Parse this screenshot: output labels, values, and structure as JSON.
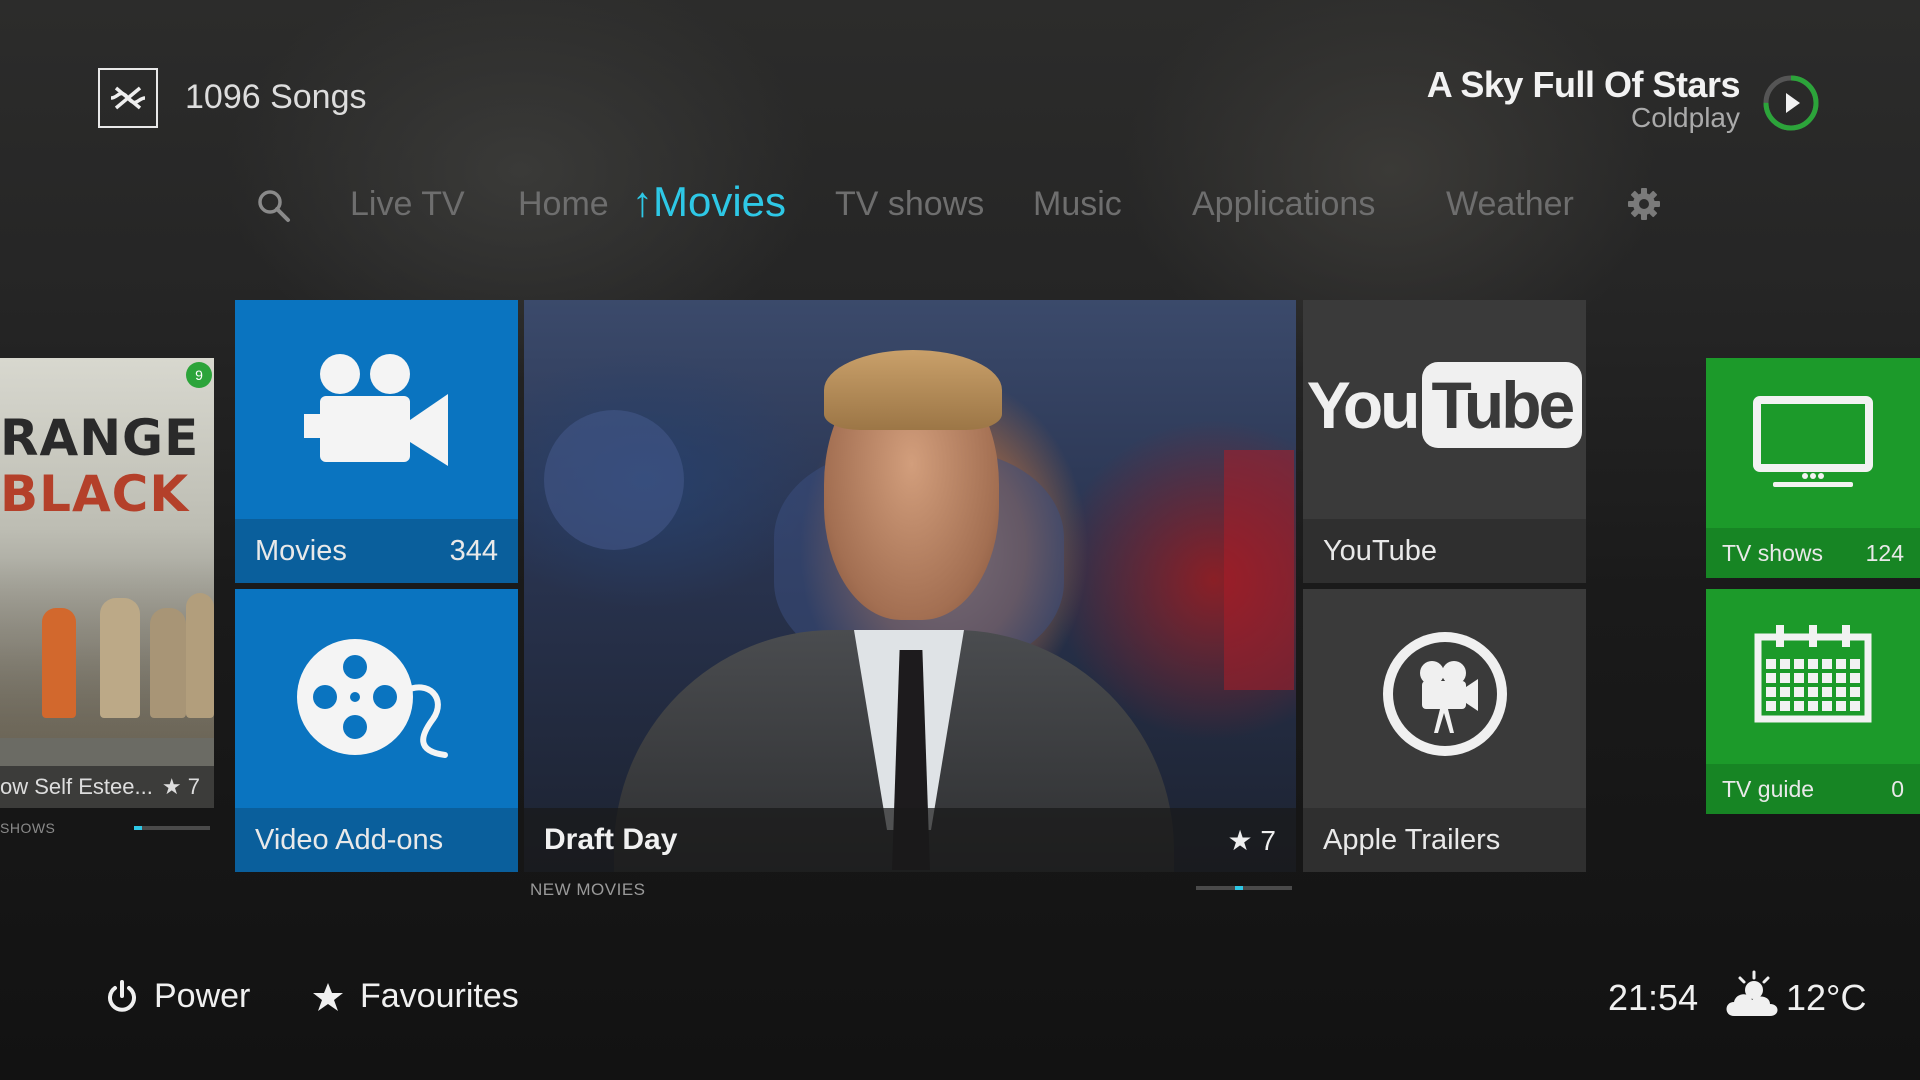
{
  "header": {
    "songs_count": "1096 Songs",
    "now_playing": {
      "title": "A Sky Full Of Stars",
      "artist": "Coldplay",
      "progress": 0.75
    }
  },
  "nav": {
    "items": [
      "Live TV",
      "Home",
      "Movies",
      "TV shows",
      "Music",
      "Applications",
      "Weather"
    ],
    "active": "↑Movies",
    "search_icon": "search-icon",
    "settings_icon": "gear-icon"
  },
  "left_poster": {
    "title_line1": "RANGE",
    "title_line2": "BLACK",
    "badge": "9",
    "episode_title": "ow Self Estee...",
    "rating": "★ 7",
    "section": "SHOWS",
    "progress": 0.1
  },
  "tiles": {
    "movies": {
      "label": "Movies",
      "count": "344",
      "icon": "movie-camera-icon"
    },
    "video_addons": {
      "label": "Video Add-ons",
      "icon": "film-reel-icon"
    },
    "featured": {
      "title": "Draft Day",
      "rating": "★ 7",
      "section": "NEW MOVIES",
      "progress": 0.45
    },
    "youtube": {
      "label": "YouTube",
      "logo_you": "You",
      "logo_tube": "Tube"
    },
    "apple_trailers": {
      "label": "Apple Trailers",
      "icon": "camera-circle-icon"
    },
    "tv_shows": {
      "label": "TV shows",
      "count": "124",
      "icon": "tv-icon"
    },
    "tv_guide": {
      "label": "TV guide",
      "count": "0",
      "icon": "calendar-icon"
    }
  },
  "footer": {
    "power": "Power",
    "favourites": "Favourites",
    "time": "21:54",
    "temperature": "12°C",
    "weather_icon": "cloud-sun-icon"
  },
  "colors": {
    "accent": "#2ec8e6",
    "tile_blue": "#0a74c0",
    "tile_green": "#1c9a2a",
    "tile_gray": "#3a3a3a"
  }
}
